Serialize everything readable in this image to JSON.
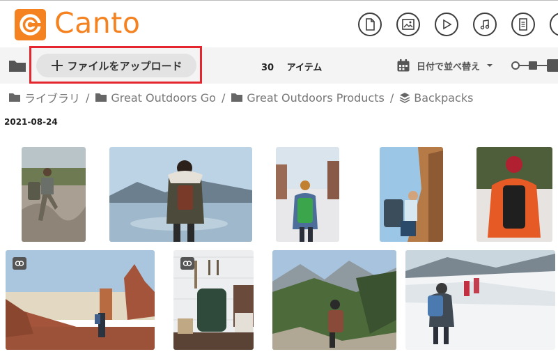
{
  "brand": {
    "name": "Canto",
    "color": "#f58220"
  },
  "header": {
    "type_filters": [
      {
        "name": "document-icon"
      },
      {
        "name": "image-icon"
      },
      {
        "name": "video-icon"
      },
      {
        "name": "audio-icon"
      },
      {
        "name": "other-file-icon"
      }
    ]
  },
  "toolbar": {
    "upload_label": "ファイルをアップロード",
    "upload_icon": "plus-icon",
    "item_count": "30",
    "item_count_label": "アイテム",
    "sort_label": "日付で並べ替え",
    "sort_icon": "calendar-icon",
    "highlight_color": "#e4262f"
  },
  "breadcrumb": {
    "items": [
      "ライブラリ",
      "Great Outdoors Go",
      "Great Outdoors Products",
      "Backpacks"
    ],
    "separator": "/"
  },
  "gallery": {
    "date_heading": "2021-08-24",
    "items": [
      {
        "description": "hiker on rocks",
        "badge": false
      },
      {
        "description": "woman at lake",
        "badge": false
      },
      {
        "description": "hiker green backpack snow",
        "badge": false
      },
      {
        "description": "smiling hiker canyon",
        "badge": false
      },
      {
        "description": "orange jacket hiker",
        "badge": false
      },
      {
        "description": "desert rock formations",
        "badge": true
      },
      {
        "description": "backpack on wall",
        "badge": true
      },
      {
        "description": "hiker mountain valley",
        "badge": false
      },
      {
        "description": "hikers snowy slope",
        "badge": false
      }
    ]
  }
}
